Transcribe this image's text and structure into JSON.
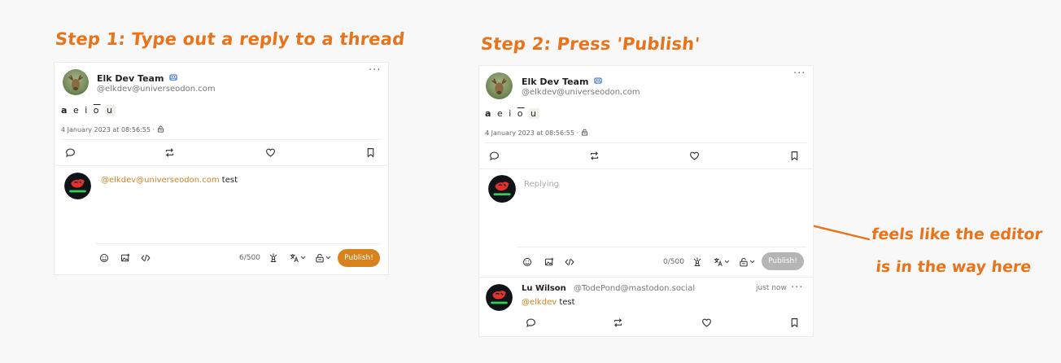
{
  "annotations": {
    "step1_title": "Step 1: Type out a reply to a thread",
    "step2_title": "Step 2: Press 'Publish'",
    "note_line1": "feels like the editor",
    "note_line2": "is in the way here"
  },
  "post": {
    "author_name": "Elk Dev Team",
    "author_handle": "@elkdev@universeodon.com",
    "status_text": [
      "a",
      "e",
      "i",
      "o",
      "u"
    ],
    "date": "4 January 2023 at 08:56:55 ·"
  },
  "step1": {
    "reply_mention": "@elkdev@universeodon.com",
    "reply_text": " test",
    "counter": "6/500",
    "publish_label": "Publish!"
  },
  "step2": {
    "placeholder": "Replying",
    "counter": "0/500",
    "publish_label": "Publish!",
    "reply": {
      "author_name": "Lu Wilson",
      "author_handle": "@TodePond@mastodon.social",
      "time": "just now",
      "mention": "@elkdev",
      "text": " test"
    }
  },
  "colors": {
    "accent": "#e8731a",
    "publish_enabled": "#d9821c",
    "publish_disabled": "#b5b5b5",
    "mention": "#d4801f"
  },
  "icons": [
    "reply-icon",
    "boost-icon",
    "favourite-icon",
    "bookmark-icon",
    "emoji-icon",
    "media-icon",
    "code-icon",
    "schedule-icon",
    "translate-icon",
    "visibility-icon",
    "more-icon",
    "verified-icon",
    "lock-icon"
  ]
}
